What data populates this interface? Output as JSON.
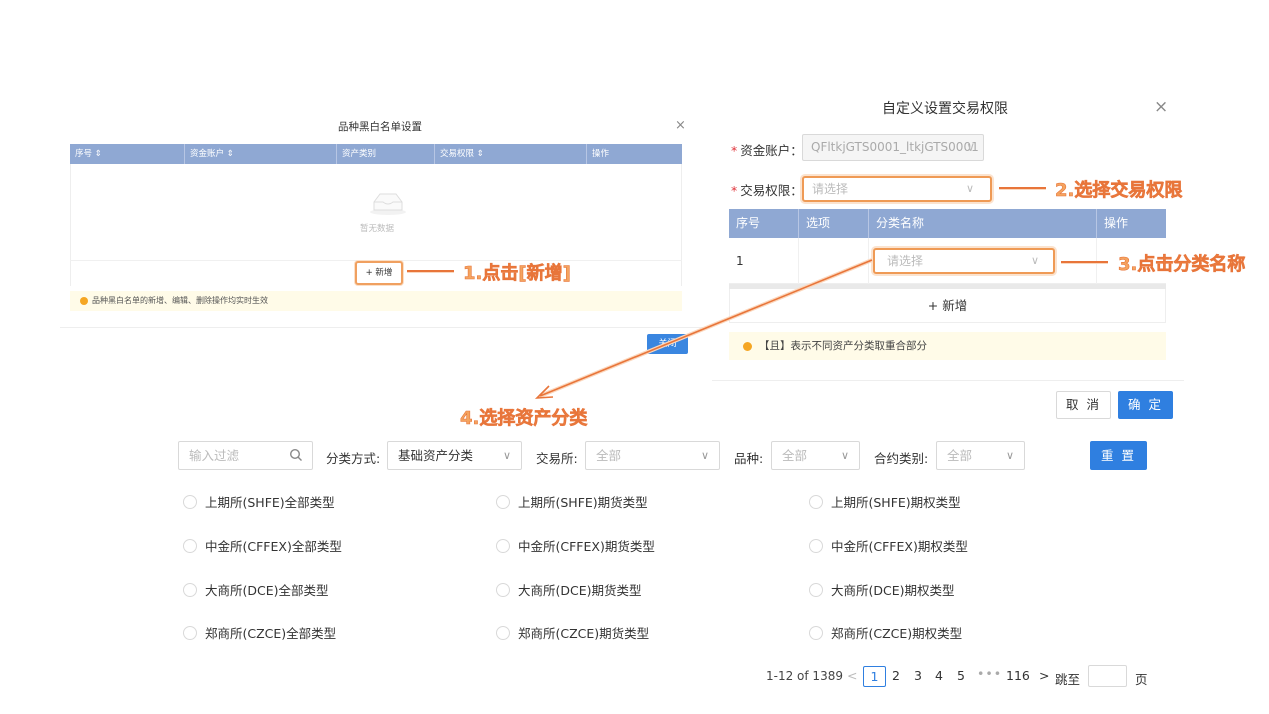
{
  "left_dialog": {
    "title": "品种黑白名单设置",
    "close": "×",
    "columns": [
      "序号 ⇕",
      "资金账户 ⇕",
      "资产类别",
      "交易权限 ⇕",
      "操作"
    ],
    "empty_text": "暂无数据",
    "add_label": "+ 新增",
    "tip": "品种黑白名单的新增、编辑、删除操作均实时生效",
    "confirm": "关闭"
  },
  "right_dialog": {
    "title": "自定义设置交易权限",
    "close": "×",
    "account_label": "资金账户：",
    "account_value": "QFltkjGTS0001_ltkjGTS0001",
    "perm_label": "交易权限：",
    "perm_placeholder": "请选择",
    "table_columns": [
      "序号",
      "选项",
      "分类名称",
      "操作"
    ],
    "row_index": "1",
    "category_placeholder": "请选择",
    "add_label": "+ 新增",
    "tip": "【且】表示不同资产分类取重合部分",
    "cancel": "取 消",
    "ok": "确 定"
  },
  "annotations": {
    "step1": "1.点击[新增]",
    "step2": "2.选择交易权限",
    "step3": "3.点击分类名称",
    "step4": "4.选择资产分类",
    "color": "#e8753a"
  },
  "selector": {
    "filter_placeholder": "输入过滤",
    "class_label": "分类方式:",
    "class_value": "基础资产分类",
    "exchange_label": "交易所:",
    "exchange_value": "全部",
    "variety_label": "品种:",
    "variety_value": "全部",
    "contract_label": "合约类别:",
    "contract_value": "全部",
    "reset": "重 置",
    "options": [
      "上期所(SHFE)全部类型",
      "上期所(SHFE)期货类型",
      "上期所(SHFE)期权类型",
      "中金所(CFFEX)全部类型",
      "中金所(CFFEX)期货类型",
      "中金所(CFFEX)期权类型",
      "大商所(DCE)全部类型",
      "大商所(DCE)期货类型",
      "大商所(DCE)期权类型",
      "郑商所(CZCE)全部类型",
      "郑商所(CZCE)期货类型",
      "郑商所(CZCE)期权类型"
    ]
  },
  "pagination": {
    "total": "1-12 of 1389",
    "prev": "<",
    "pages": [
      "1",
      "2",
      "3",
      "4",
      "5"
    ],
    "dots": "•••",
    "last": "116",
    "next": ">",
    "jump_label": "跳至",
    "page_label": "页"
  },
  "colors": {
    "primary": "#2f7fe0",
    "table_header": "#8fa8d3",
    "highlight": "#ef9a55",
    "tip_bg": "#fffbe8"
  }
}
